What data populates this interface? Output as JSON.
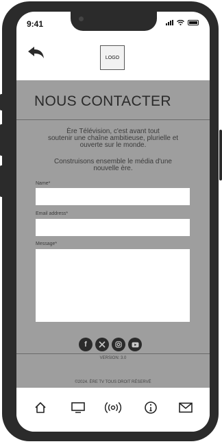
{
  "status_bar": {
    "time": "9:41"
  },
  "header": {
    "logo_text": "LOGO"
  },
  "page": {
    "title": "NOUS CONTACTER",
    "intro_line1": "Ère Télévision, c'est avant tout",
    "intro_line2": "soutenir une chaîne ambitieuse, plurielle et",
    "intro_line3": "ouverte sur le monde.",
    "intro2_line1": "Construisons ensemble le média d'une",
    "intro2_line2": "nouvelle ère."
  },
  "form": {
    "name_label": "Name*",
    "name_value": "",
    "email_label": "Email address*",
    "email_value": "",
    "message_label": "Message*",
    "message_value": ""
  },
  "footer": {
    "version": "VERSION: 3.0",
    "copyright": "©2024. ÈRE TV TOUS DROIT RÉSERVÉ"
  },
  "socials": [
    "facebook-icon",
    "x-icon",
    "instagram-icon",
    "youtube-icon"
  ],
  "nav": [
    "home-icon",
    "tv-icon",
    "broadcast-icon",
    "info-icon",
    "mail-icon"
  ]
}
